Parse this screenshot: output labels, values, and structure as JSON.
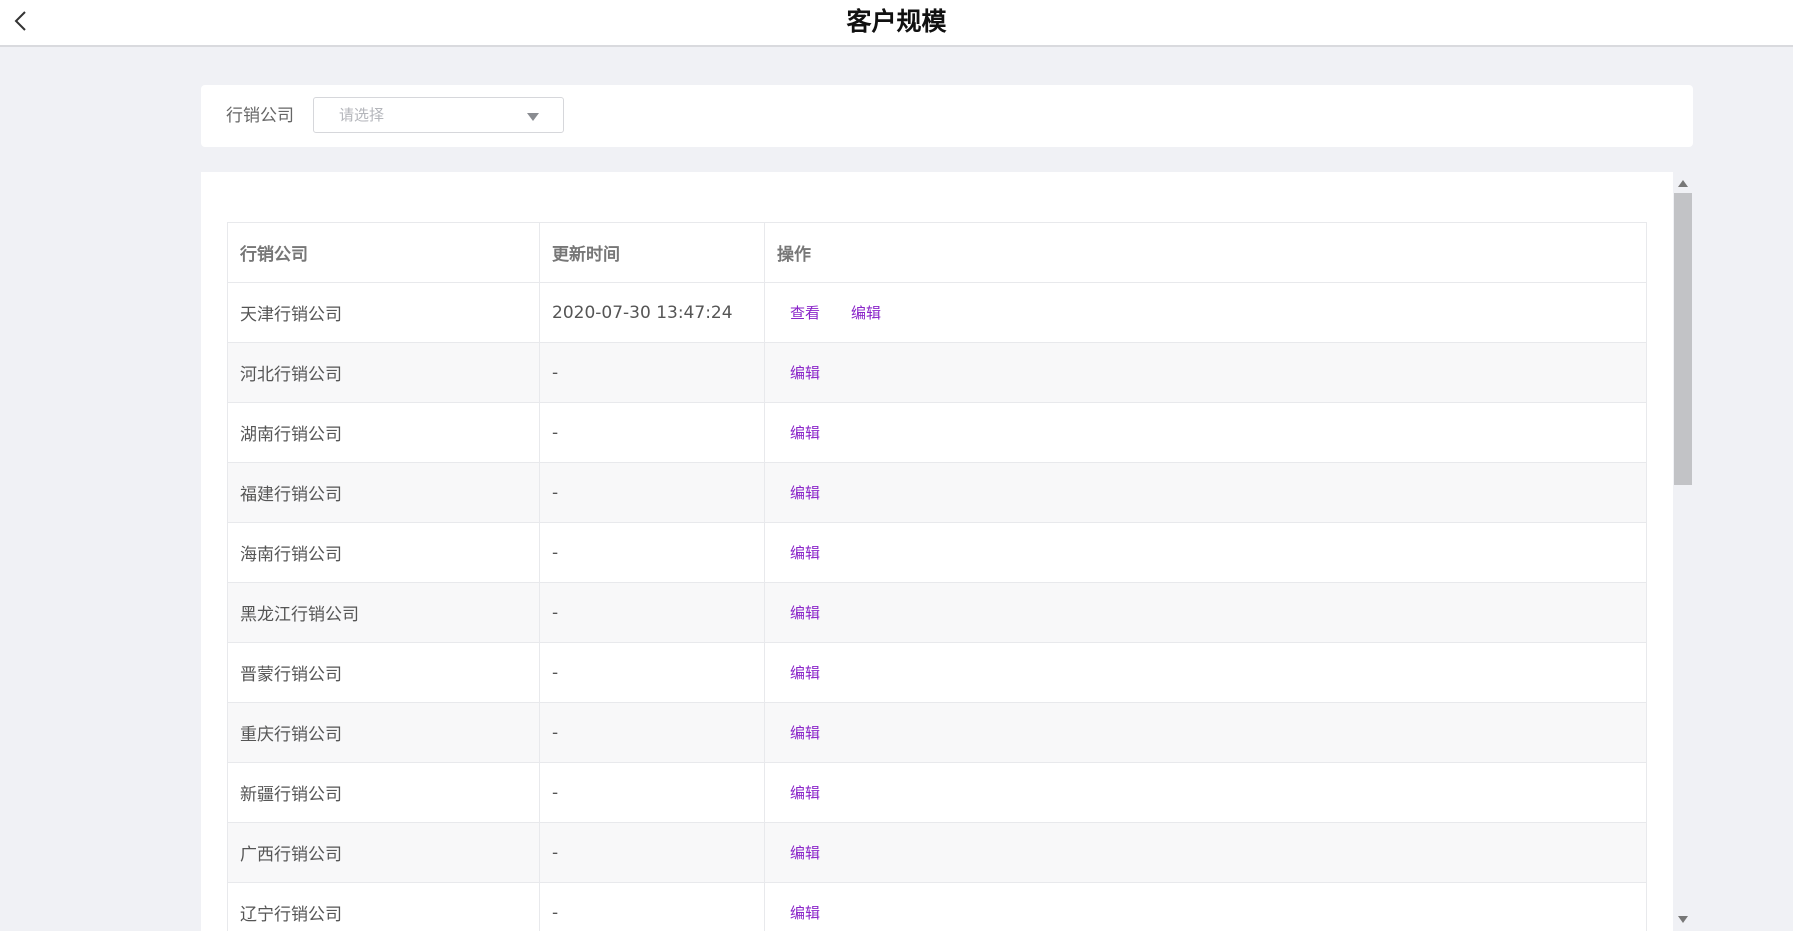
{
  "header": {
    "title": "客户规模",
    "back_icon": "chevron-left-icon"
  },
  "filter": {
    "label": "行销公司",
    "placeholder": "请选择",
    "arrow_icon": "caret-down-icon"
  },
  "table": {
    "columns": [
      "行销公司",
      "更新时间",
      "操作"
    ],
    "rows": [
      {
        "company": "天津行销公司",
        "updated": "2020-07-30 13:47:24",
        "actions": [
          "查看",
          "编辑"
        ]
      },
      {
        "company": "河北行销公司",
        "updated": "-",
        "actions": [
          "编辑"
        ]
      },
      {
        "company": "湖南行销公司",
        "updated": "-",
        "actions": [
          "编辑"
        ]
      },
      {
        "company": "福建行销公司",
        "updated": "-",
        "actions": [
          "编辑"
        ]
      },
      {
        "company": "海南行销公司",
        "updated": "-",
        "actions": [
          "编辑"
        ]
      },
      {
        "company": "黑龙江行销公司",
        "updated": "-",
        "actions": [
          "编辑"
        ]
      },
      {
        "company": "晋蒙行销公司",
        "updated": "-",
        "actions": [
          "编辑"
        ]
      },
      {
        "company": "重庆行销公司",
        "updated": "-",
        "actions": [
          "编辑"
        ]
      },
      {
        "company": "新疆行销公司",
        "updated": "-",
        "actions": [
          "编辑"
        ]
      },
      {
        "company": "广西行销公司",
        "updated": "-",
        "actions": [
          "编辑"
        ]
      },
      {
        "company": "辽宁行销公司",
        "updated": "-",
        "actions": [
          "编辑"
        ]
      }
    ]
  },
  "colors": {
    "accent_link": "#8a24c9",
    "page_bg": "#f0f1f5"
  }
}
